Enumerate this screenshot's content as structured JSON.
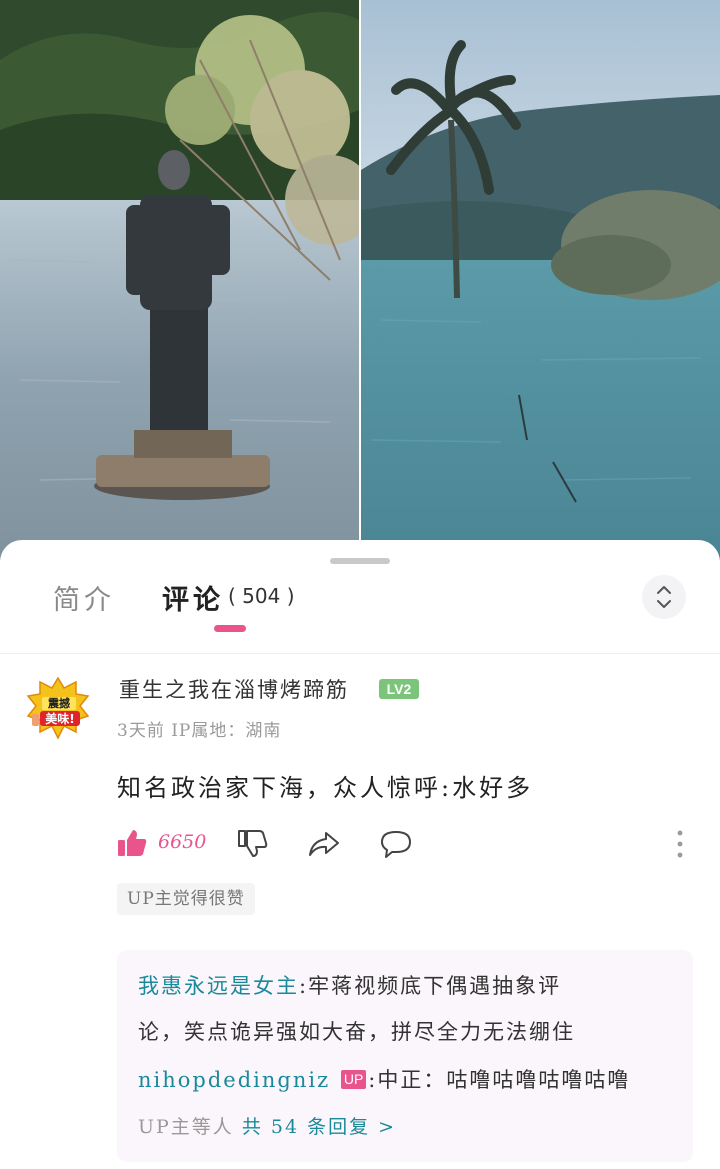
{
  "video": {
    "left_scene": "statue-in-lake",
    "right_scene": "palm-tree-in-lake"
  },
  "tabs": {
    "intro_label": "简介",
    "comments_label": "评论",
    "comments_count": "( 504 )",
    "active": "comments"
  },
  "icons": {
    "sort": "sort-updown-icon",
    "like": "thumb-up-icon",
    "dislike": "thumb-down-icon",
    "share": "share-icon",
    "reply": "comment-bubble-icon",
    "more": "more-vertical-icon"
  },
  "colors": {
    "accent": "#e8548b",
    "link": "#1a8a9a",
    "level_badge": "#7cc47a"
  },
  "comment": {
    "username": "重生之我在淄博烤蹄筋",
    "level": "LV2",
    "avatar_text_top": "震撼",
    "avatar_text_bottom": "美味!",
    "meta": "3天前 IP属地：湖南",
    "content": "知名政治家下海，众人惊呼:水好多",
    "likes": "6650",
    "up_like_tag": "UP主觉得很赞"
  },
  "replies": {
    "reply1_user": "我惠永远是女主",
    "reply1_text_a": ":牢蒋视频底下偶遇抽象评",
    "reply1_text_b": "论，笑点诡异强如大奋，拼尽全力无法绷住",
    "reply2_user": "nihopdedingniz",
    "reply2_badge": "UP",
    "reply2_text": ":中正：咕噜咕噜咕噜咕噜",
    "footer_prefix": "UP主等人",
    "footer_link": "共 54 条回复 >"
  }
}
